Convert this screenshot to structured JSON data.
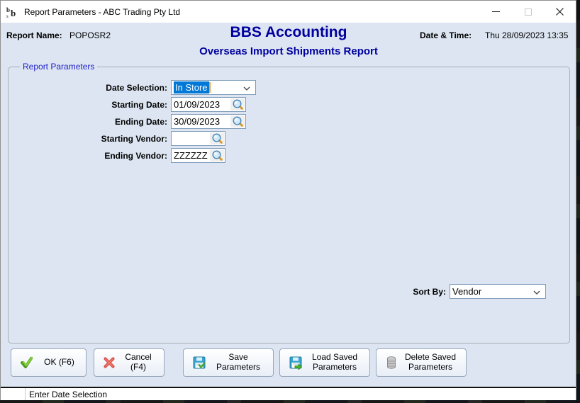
{
  "titlebar": {
    "title": "Report Parameters - ABC Trading Pty Ltd"
  },
  "header": {
    "report_name_label": "Report Name:",
    "report_name_value": "POPOSR2",
    "app_title": "BBS Accounting",
    "report_title": "Overseas Import Shipments Report",
    "datetime_label": "Date & Time:",
    "datetime_value": "Thu 28/09/2023 13:35"
  },
  "params": {
    "group_label": "Report Parameters",
    "rows": [
      {
        "label": "Date Selection:",
        "value": "In Store"
      },
      {
        "label": "Starting Date:",
        "value": "01/09/2023"
      },
      {
        "label": "Ending Date:",
        "value": "30/09/2023"
      },
      {
        "label": "Starting Vendor:",
        "value": ""
      },
      {
        "label": "Ending Vendor:",
        "value": "ZZZZZZ"
      }
    ],
    "sort_by": {
      "label": "Sort By:",
      "value": "Vendor"
    }
  },
  "buttons": {
    "ok": "OK (F6)",
    "cancel": "Cancel (F4)",
    "save": "Save Parameters",
    "load": "Load Saved Parameters",
    "delete": "Delete Saved Parameters"
  },
  "status": {
    "message": "Enter Date Selection"
  },
  "colors": {
    "content_bg": "#dce5f1",
    "title_navy": "#00009e",
    "group_label_blue": "#2222cc",
    "selection_blue": "#0078d7",
    "field_border": "#7f9db9"
  }
}
